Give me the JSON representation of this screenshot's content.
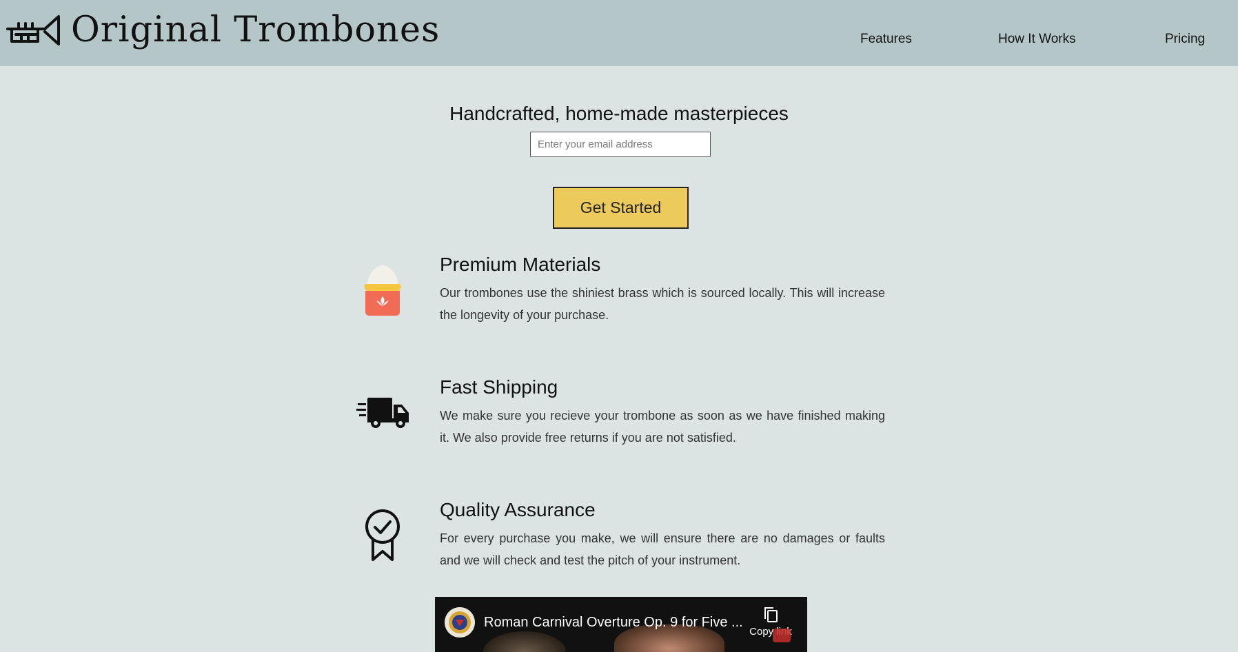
{
  "header": {
    "brand": "Original Trombones",
    "nav": [
      "Features",
      "How It Works",
      "Pricing"
    ]
  },
  "hero": {
    "title": "Handcrafted, home-made masterpieces",
    "email_placeholder": "Enter your email address",
    "cta_label": "Get Started"
  },
  "features": [
    {
      "icon": "materials-bag-icon",
      "title": "Premium Materials",
      "description": "Our trombones use the shiniest brass which is sourced locally. This will increase the longevity of your purchase."
    },
    {
      "icon": "delivery-truck-icon",
      "title": "Fast Shipping",
      "description": "We make sure you recieve your trombone as soon as we have finished making it. We also provide free returns if you are not satisfied."
    },
    {
      "icon": "quality-badge-icon",
      "title": "Quality Assurance",
      "description": "For every purchase you make, we will ensure there are no damages or faults and we will check and test the pitch of your instrument."
    }
  ],
  "video": {
    "title": "Roman Carnival Overture Op. 9 for Five ...",
    "copy_link_label": "Copy link"
  },
  "colors": {
    "header_bg": "#b5c6c9",
    "page_bg": "#dbe3e3",
    "cta_bg": "#ecca5c"
  }
}
